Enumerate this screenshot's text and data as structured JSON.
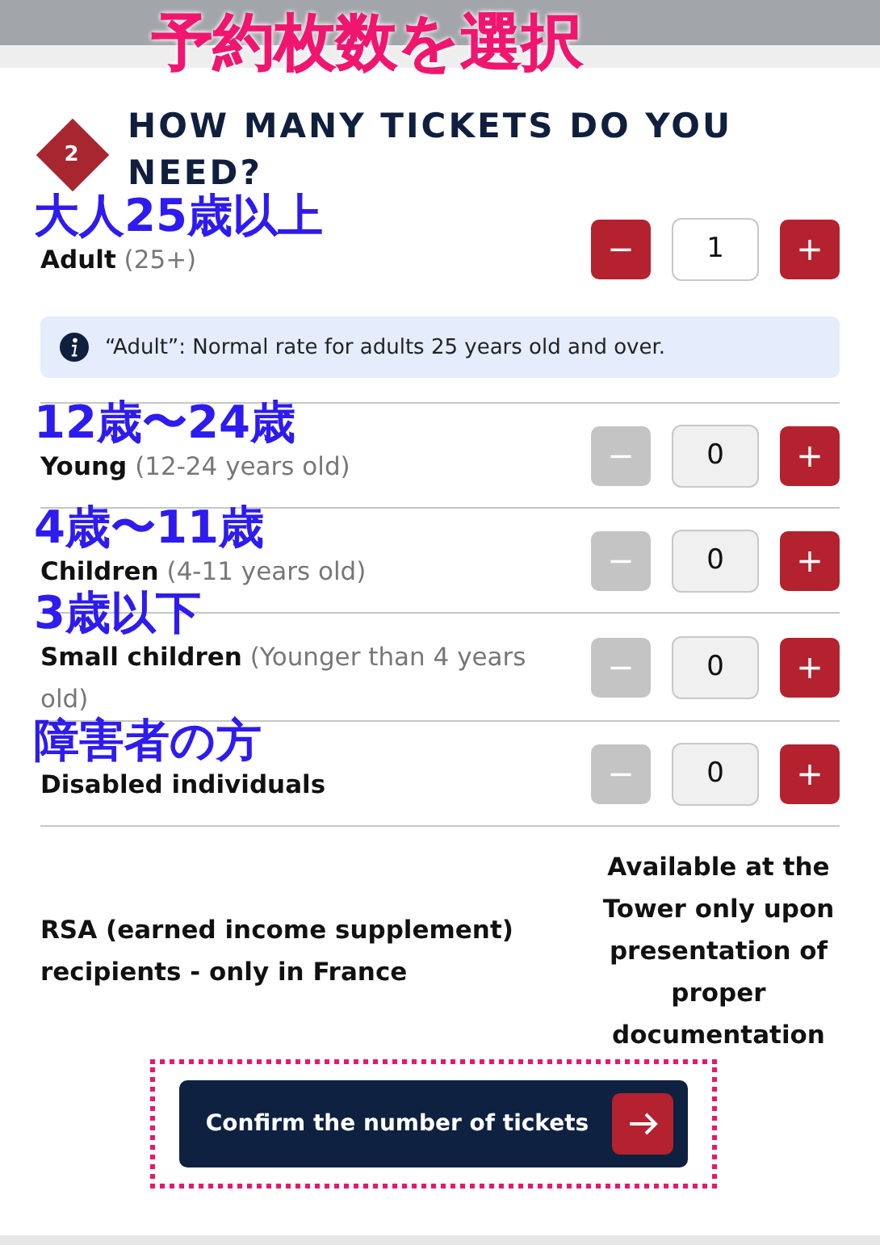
{
  "annotation_title": "予約枚数を選択",
  "step": {
    "number": "2",
    "title": "HOW MANY TICKETS DO YOU NEED?"
  },
  "rows": [
    {
      "annotation": "大人25歳以上",
      "label": "Adult",
      "detail": "(25+)",
      "value": "1",
      "decrement_disabled": false,
      "minus": "−",
      "plus": "+",
      "info": "“Adult”: Normal rate for adults 25 years old and over."
    },
    {
      "annotation": "12歳〜24歳",
      "label": "Young",
      "detail": "(12-24 years old)",
      "value": "0",
      "decrement_disabled": true,
      "minus": "−",
      "plus": "+"
    },
    {
      "annotation": "4歳〜11歳",
      "label": "Children",
      "detail": "(4-11 years old)",
      "value": "0",
      "decrement_disabled": true,
      "minus": "−",
      "plus": "+"
    },
    {
      "annotation": "3歳以下",
      "label": "Small children",
      "detail": "(Younger than 4 years old)",
      "value": "0",
      "decrement_disabled": true,
      "minus": "−",
      "plus": "+"
    },
    {
      "annotation": "障害者の方",
      "label": "Disabled individuals",
      "value": "0",
      "decrement_disabled": true,
      "minus": "−",
      "plus": "+"
    }
  ],
  "rsa": {
    "label": "RSA (earned income supplement) recipients - only in France",
    "note": "Available at the Tower only upon presentation of proper documentation"
  },
  "confirm_button": {
    "label": "Confirm the number of tickets",
    "highlighted": true
  }
}
